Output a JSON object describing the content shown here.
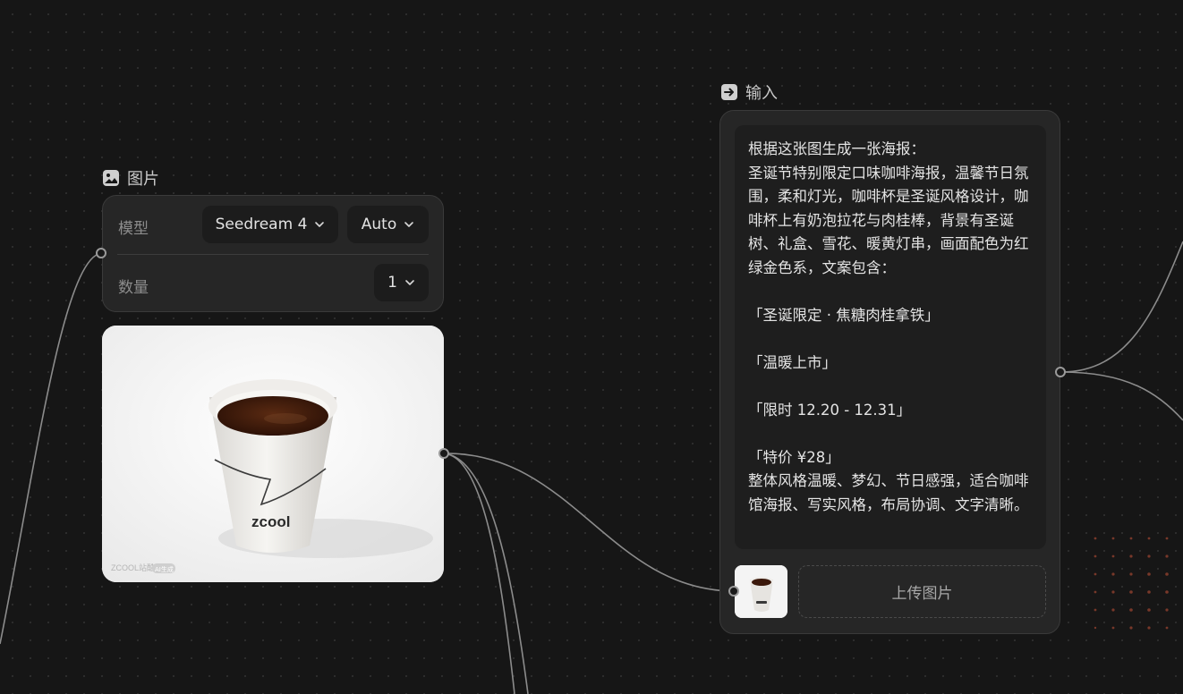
{
  "image_node": {
    "title": "图片",
    "title_icon": "image-icon",
    "model_label": "模型",
    "model_value": "Seedream 4",
    "ratio_value": "Auto",
    "count_label": "数量",
    "count_value": "1",
    "cup_logo": "zcool",
    "watermark": "ZCOOL站酷",
    "ai_badge": "AI生成"
  },
  "input_node": {
    "title": "输入",
    "title_icon": "arrow-right-box-icon",
    "prompt": "根据这张图生成一张海报：\n圣诞节特别限定口味咖啡海报，温馨节日氛围，柔和灯光，咖啡杯是圣诞风格设计，咖啡杯上有奶泡拉花与肉桂棒，背景有圣诞树、礼盒、雪花、暖黄灯串，画面配色为红绿金色系，文案包含：\n\n「圣诞限定 · 焦糖肉桂拿铁」\n\n「温暖上市」\n\n「限时 12.20 - 12.31」\n\n「特价 ¥28」\n整体风格温暖、梦幻、节日感强，适合咖啡馆海报、写实风格，布局协调、文字清晰。",
    "upload_label": "上传图片"
  },
  "colors": {
    "canvas_bg": "#161616",
    "card_bg": "#262626",
    "wire": "#9a9a9a",
    "accent_dots": "#c8553a"
  }
}
